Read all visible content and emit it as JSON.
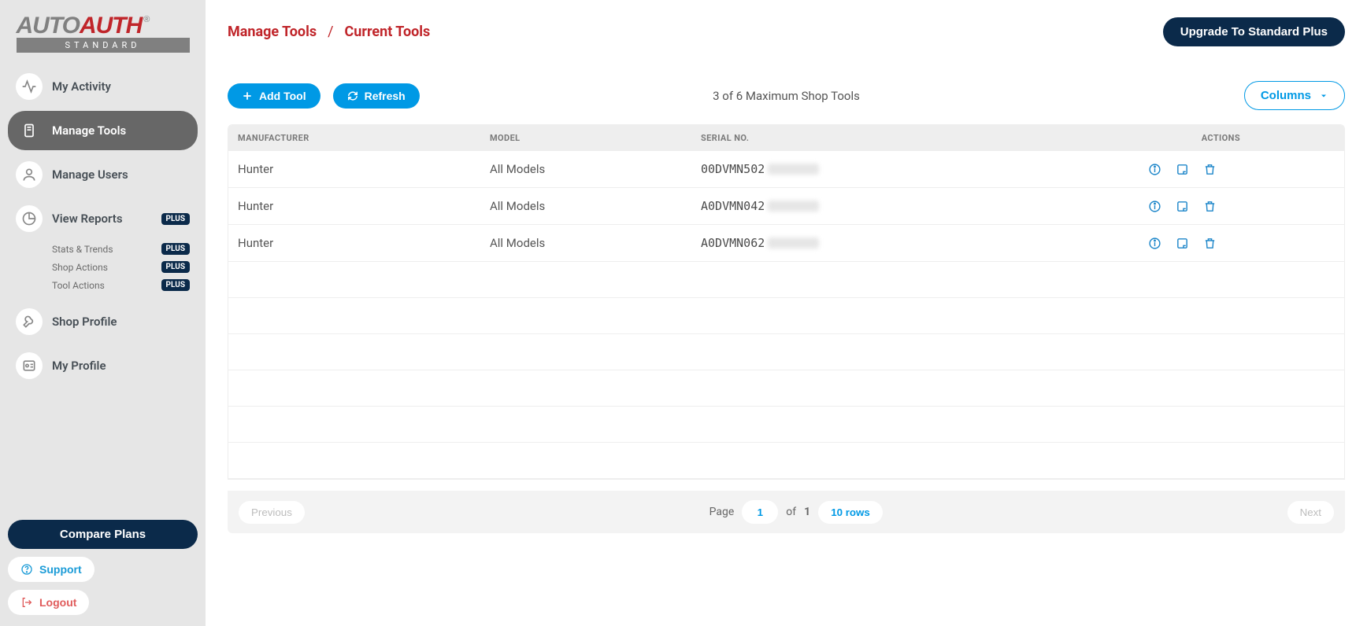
{
  "brand": {
    "name_a": "AUTO",
    "name_b": "AUTH",
    "reg": "®",
    "tier": "STANDARD"
  },
  "sidebar": {
    "items": [
      {
        "label": "My Activity"
      },
      {
        "label": "Manage Tools"
      },
      {
        "label": "Manage Users"
      },
      {
        "label": "View Reports",
        "badge": "PLUS"
      },
      {
        "label": "Shop Profile"
      },
      {
        "label": "My Profile"
      }
    ],
    "reports_sub": [
      {
        "label": "Stats & Trends",
        "badge": "PLUS"
      },
      {
        "label": "Shop Actions",
        "badge": "PLUS"
      },
      {
        "label": "Tool Actions",
        "badge": "PLUS"
      }
    ],
    "compare": "Compare Plans",
    "support": "Support",
    "logout": "Logout"
  },
  "header": {
    "breadcrumb": [
      "Manage Tools",
      "Current Tools"
    ],
    "sep": "/",
    "upgrade": "Upgrade To Standard Plus"
  },
  "toolbar": {
    "add": "Add Tool",
    "refresh": "Refresh",
    "count": "3 of 6 Maximum Shop Tools",
    "columns": "Columns"
  },
  "table": {
    "headers": {
      "mfr": "MANUFACTURER",
      "model": "MODEL",
      "serial": "SERIAL NO.",
      "actions": "ACTIONS"
    },
    "rows": [
      {
        "mfr": "Hunter",
        "model": "All Models",
        "serial": "00DVMN502"
      },
      {
        "mfr": "Hunter",
        "model": "All Models",
        "serial": "A0DVMN042"
      },
      {
        "mfr": "Hunter",
        "model": "All Models",
        "serial": "A0DVMN062"
      }
    ]
  },
  "pagination": {
    "prev": "Previous",
    "next": "Next",
    "page_label": "Page",
    "page": "1",
    "of": "of",
    "total": "1",
    "rowsel": "10 rows"
  }
}
